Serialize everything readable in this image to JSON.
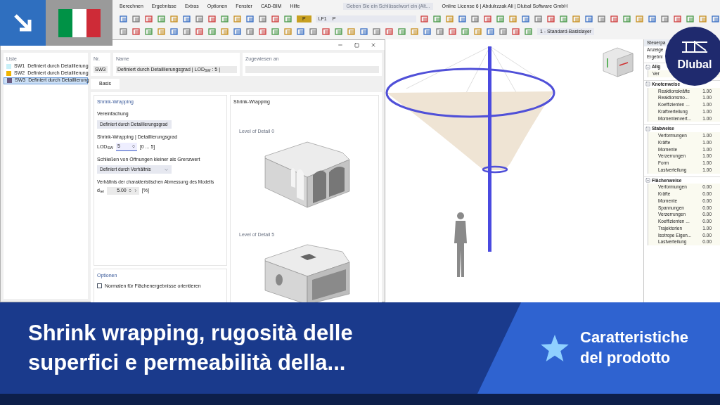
{
  "menu": [
    "Berechnen",
    "Ergebnisse",
    "Extras",
    "Optionen",
    "Fenster",
    "CAD-BIM",
    "Hilfe"
  ],
  "search": {
    "placeholder": "Geben Sie ein Schlüsselwort ein (Alt..."
  },
  "license": "Online License 6 | Abdulrzzak Ali | Dlubal Software GmbH",
  "toolbar": {
    "badge": "P",
    "load_case": "LF1",
    "load_name": "P",
    "layer": "1 - Standard-Basislayer"
  },
  "dialog": {
    "list_title": "Liste",
    "items": [
      {
        "number": "SW1",
        "name": "Definiert durch Detaillierung",
        "color": "#c8f0f8",
        "selected": false
      },
      {
        "number": "SW2",
        "name": "Definiert durch Detaillierung",
        "color": "#f0b400",
        "selected": false
      },
      {
        "number": "SW3",
        "name": "Definiert durch Detaillierung",
        "color": "#6a5a80",
        "selected": true
      }
    ],
    "number_label": "Nr.",
    "number": "SW3",
    "name_label": "Name",
    "name": "Definiert durch Detaillierungsgrad | LOD$_{SW}$ : 5 |",
    "assigned_label": "Zugewiesen an",
    "tabs": [
      {
        "label": "Basis",
        "selected": true
      }
    ],
    "settings": {
      "title": "Shrink-Wrapping",
      "simplification_label": "Vereinfachung",
      "simplification": "Definiert durch Detaillierungsgrad",
      "lod_heading": "Shrink-Wrapping | Detaillierungsgrad",
      "lod_label": "LOD$_{SW}$",
      "lod_value": "5",
      "lod_range": "[0 ... 5]",
      "openings_label": "Schließen von Öffnungen kleiner als Grenzwert",
      "openings": "Definiert durch Verhältnis",
      "ratio_label": "Verhältnis der charakteristischen Abmessung des Modells",
      "ratio_symbol": "d$_{rel}$",
      "ratio_value": "5.00",
      "ratio_unit": "[%]"
    },
    "options": {
      "title": "Optionen",
      "items": [
        {
          "label": "Normalen für Flächenergebnisse orientieren",
          "checked": false
        }
      ]
    },
    "preview": {
      "title": "Shrink-Wrapping",
      "images": [
        {
          "caption": "Level of Detail 0",
          "kind": "lod0"
        },
        {
          "caption": "Level of Detail 5",
          "kind": "lod5"
        }
      ]
    }
  },
  "panel": {
    "title": "Steuerpa",
    "lines": [
      "Anzeige",
      "Ergebni"
    ],
    "groups": [
      {
        "label": "Allg",
        "expanded": true,
        "rows": [
          {
            "label": "Ver"
          }
        ]
      },
      {
        "label": "Knotenweise",
        "expanded": true,
        "rows": [
          {
            "label": "Reaktionskräfte",
            "value": "1.00"
          },
          {
            "label": "Reaktionsmo...",
            "value": "1.00"
          },
          {
            "label": "Koeffizienten ...",
            "value": "1.00"
          },
          {
            "label": "Kraftverteilung",
            "value": "1.00"
          },
          {
            "label": "Momentenvert...",
            "value": "1.00"
          }
        ]
      },
      {
        "label": "Stabweise",
        "expanded": true,
        "rows": [
          {
            "label": "Verformungen",
            "value": "1.00"
          },
          {
            "label": "Kräfte",
            "value": "1.00"
          },
          {
            "label": "Momente",
            "value": "1.00"
          },
          {
            "label": "Verzerrungen",
            "value": "1.00"
          },
          {
            "label": "Form",
            "value": "1.00"
          },
          {
            "label": "Lastverteilung",
            "value": "1.00"
          }
        ]
      },
      {
        "label": "Flächenweise",
        "expanded": true,
        "rows": [
          {
            "label": "Verformungen",
            "value": "0.00"
          },
          {
            "label": "Kräfte",
            "value": "0.00"
          },
          {
            "label": "Momente",
            "value": "0.00"
          },
          {
            "label": "Spannungen",
            "value": "0.00"
          },
          {
            "label": "Verzerrungen",
            "value": "0.00"
          },
          {
            "label": "Koeffizienten ...",
            "value": "0.00"
          },
          {
            "label": "Trajektorien",
            "value": "1.00"
          },
          {
            "label": "Isotrope Eigen...",
            "value": "0.00"
          },
          {
            "label": "Lastverteilung",
            "value": "0.00"
          }
        ]
      }
    ]
  },
  "logo": "Dlubal",
  "banner": {
    "title": "Shrink wrapping, rugosità delle superfici e permeabilità della...",
    "category": "Caratteristiche del prodotto"
  }
}
